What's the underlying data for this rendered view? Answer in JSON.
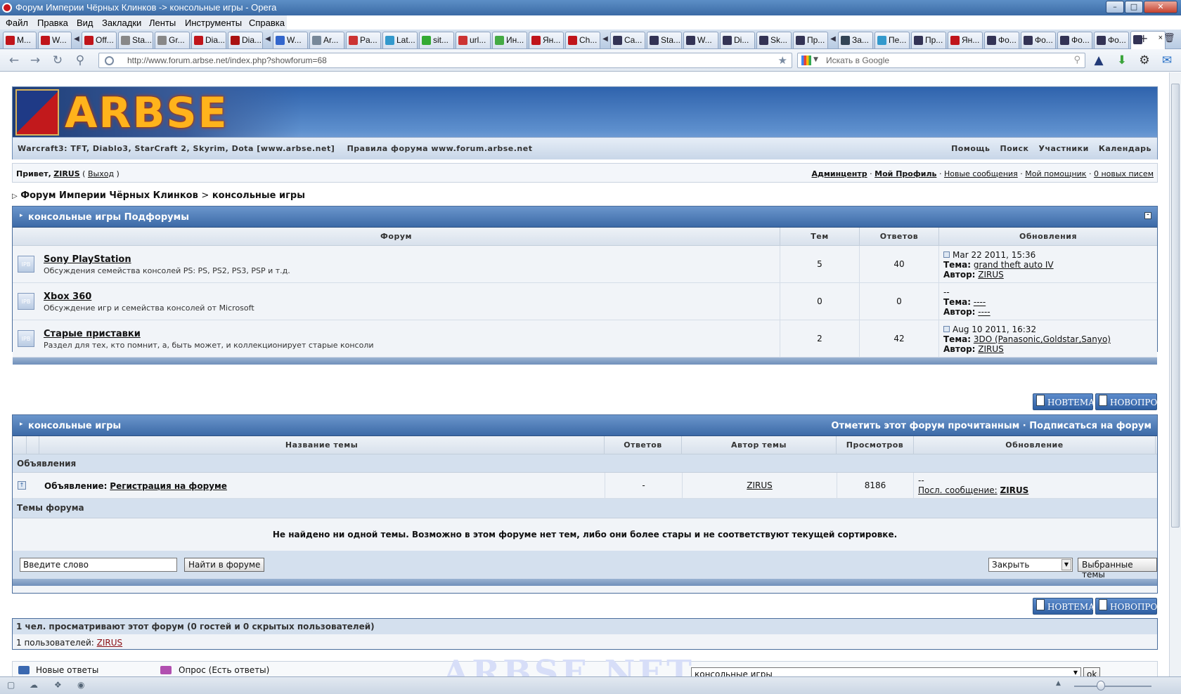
{
  "window": {
    "title": "Форум Империи Чёрных Клинков -> консольные игры - Opera"
  },
  "menu": [
    "Файл",
    "Правка",
    "Вид",
    "Закладки",
    "Ленты",
    "Инструменты",
    "Справка"
  ],
  "tabs": [
    {
      "label": "M...",
      "color": "#c0141a"
    },
    {
      "label": "W...",
      "color": "#c0141a"
    },
    {
      "label": "Off...",
      "color": "#c0141a"
    },
    {
      "label": "Sta...",
      "color": "#888"
    },
    {
      "label": "Gr...",
      "color": "#888"
    },
    {
      "label": "Dia...",
      "color": "#c0141a"
    },
    {
      "label": "Dia...",
      "color": "#a11"
    },
    {
      "label": "W...",
      "color": "#36c"
    },
    {
      "label": "Ar...",
      "color": "#789"
    },
    {
      "label": "Pa...",
      "color": "#c33"
    },
    {
      "label": "Lat...",
      "color": "#39c"
    },
    {
      "label": "sit...",
      "color": "#3a3"
    },
    {
      "label": "url...",
      "color": "#c33"
    },
    {
      "label": "Ин...",
      "color": "#4a4"
    },
    {
      "label": "Ян...",
      "color": "#c0141a"
    },
    {
      "label": "Ch...",
      "color": "#c0141a"
    },
    {
      "label": "Ca...",
      "color": "#335"
    },
    {
      "label": "Sta...",
      "color": "#335"
    },
    {
      "label": "W...",
      "color": "#335"
    },
    {
      "label": "Di...",
      "color": "#335"
    },
    {
      "label": "Sk...",
      "color": "#335"
    },
    {
      "label": "Пр...",
      "color": "#335"
    },
    {
      "label": "За...",
      "color": "#345"
    },
    {
      "label": "Пе...",
      "color": "#39c"
    },
    {
      "label": "Пр...",
      "color": "#335"
    },
    {
      "label": "Ян...",
      "color": "#c0141a"
    },
    {
      "label": "Фо...",
      "color": "#335"
    },
    {
      "label": "Фо...",
      "color": "#335"
    },
    {
      "label": "Фо...",
      "color": "#335"
    },
    {
      "label": "Фо...",
      "color": "#335"
    }
  ],
  "address": {
    "url": "http://www.forum.arbse.net/index.php?showforum=68",
    "search_placeholder": "Искать в Google"
  },
  "banner": {
    "logo": "ARBSE",
    "left": "Warcraft3: TFT, Diablo3, StarCraft 2, Skyrim, Dota [www.arbse.net]    Правила форума www.forum.arbse.net",
    "links": [
      "Помощь",
      "Поиск",
      "Участники",
      "Календарь"
    ]
  },
  "userbar": {
    "greet": "Привет,",
    "user": "ZIRUS",
    "logout": "Выход",
    "links": [
      "Админцентр",
      "Мой Профиль",
      "Новые сообщения",
      "Мой помощник",
      "0 новых писем"
    ]
  },
  "crumbs": {
    "root": "Форум Империи Чёрных Клинков",
    "sep": ">",
    "current": "консольные игры"
  },
  "subforums": {
    "title": "консольные игры Подфорумы",
    "cols": [
      "Форум",
      "Тем",
      "Ответов",
      "Обновления"
    ],
    "rows": [
      {
        "name": "Sony PlayStation",
        "desc": "Обсуждения семейства консолей PS: PS, PS2, PS3, PSP и т.д.",
        "topics": "5",
        "replies": "40",
        "date": "Mar 22 2011, 15:36",
        "topic_label": "Тема:",
        "topic": "grand theft auto IV",
        "author_label": "Автор:",
        "author": "ZIRUS"
      },
      {
        "name": "Xbox 360",
        "desc": "Обсуждение игр и семейства консолей от Microsoft",
        "topics": "0",
        "replies": "0",
        "date": "--",
        "topic_label": "Тема:",
        "topic": "----",
        "author_label": "Автор:",
        "author": "----"
      },
      {
        "name": "Старые приставки",
        "desc": "Раздел для тех, кто помнит, а, быть может, и коллекционирует старые консоли",
        "topics": "2",
        "replies": "42",
        "date": "Aug 10 2011, 16:32",
        "topic_label": "Тема:",
        "topic": "3DO (Panasonic,Goldstar,Sanyo)",
        "author_label": "Автор:",
        "author": "ZIRUS"
      }
    ]
  },
  "buttons": {
    "new_topic": "НОВТЕМА",
    "new_poll": "НОВОПРОС"
  },
  "topics": {
    "title": "консольные игры",
    "actions": "Отметить этот форум прочитанным · Подписаться на форум",
    "cols": [
      "Название темы",
      "Ответов",
      "Автор темы",
      "Просмотров",
      "Обновление"
    ],
    "ann_section": "Объявления",
    "ann_prefix": "Объявление:",
    "ann_title": "Регистрация на форуме",
    "ann_replies": "-",
    "ann_author": "ZIRUS",
    "ann_views": "8186",
    "ann_upd1": "--",
    "ann_upd_label": "Посл. сообщение:",
    "ann_upd_user": "ZIRUS",
    "section": "Темы форума",
    "empty": "Не найдено ни одной темы. Возможно в этом форуме нет тем, либо они более стары и не соответствуют текущей сортировке.",
    "search_value": "Введите слово",
    "search_btn": "Найти в форуме",
    "mod_select": "Закрыть",
    "mod_btn": "Выбранные темы"
  },
  "online": {
    "line1": "1 чел. просматривают этот форум (0 гостей и 0 скрытых пользователей)",
    "line2": "1 пользователей:",
    "user": "ZIRUS"
  },
  "legend": {
    "a": "Новые ответы",
    "b": "Опрос (Есть ответы)",
    "watermark": "ARBSE.NET",
    "jump": "консольные игры",
    "ok": "ok"
  }
}
